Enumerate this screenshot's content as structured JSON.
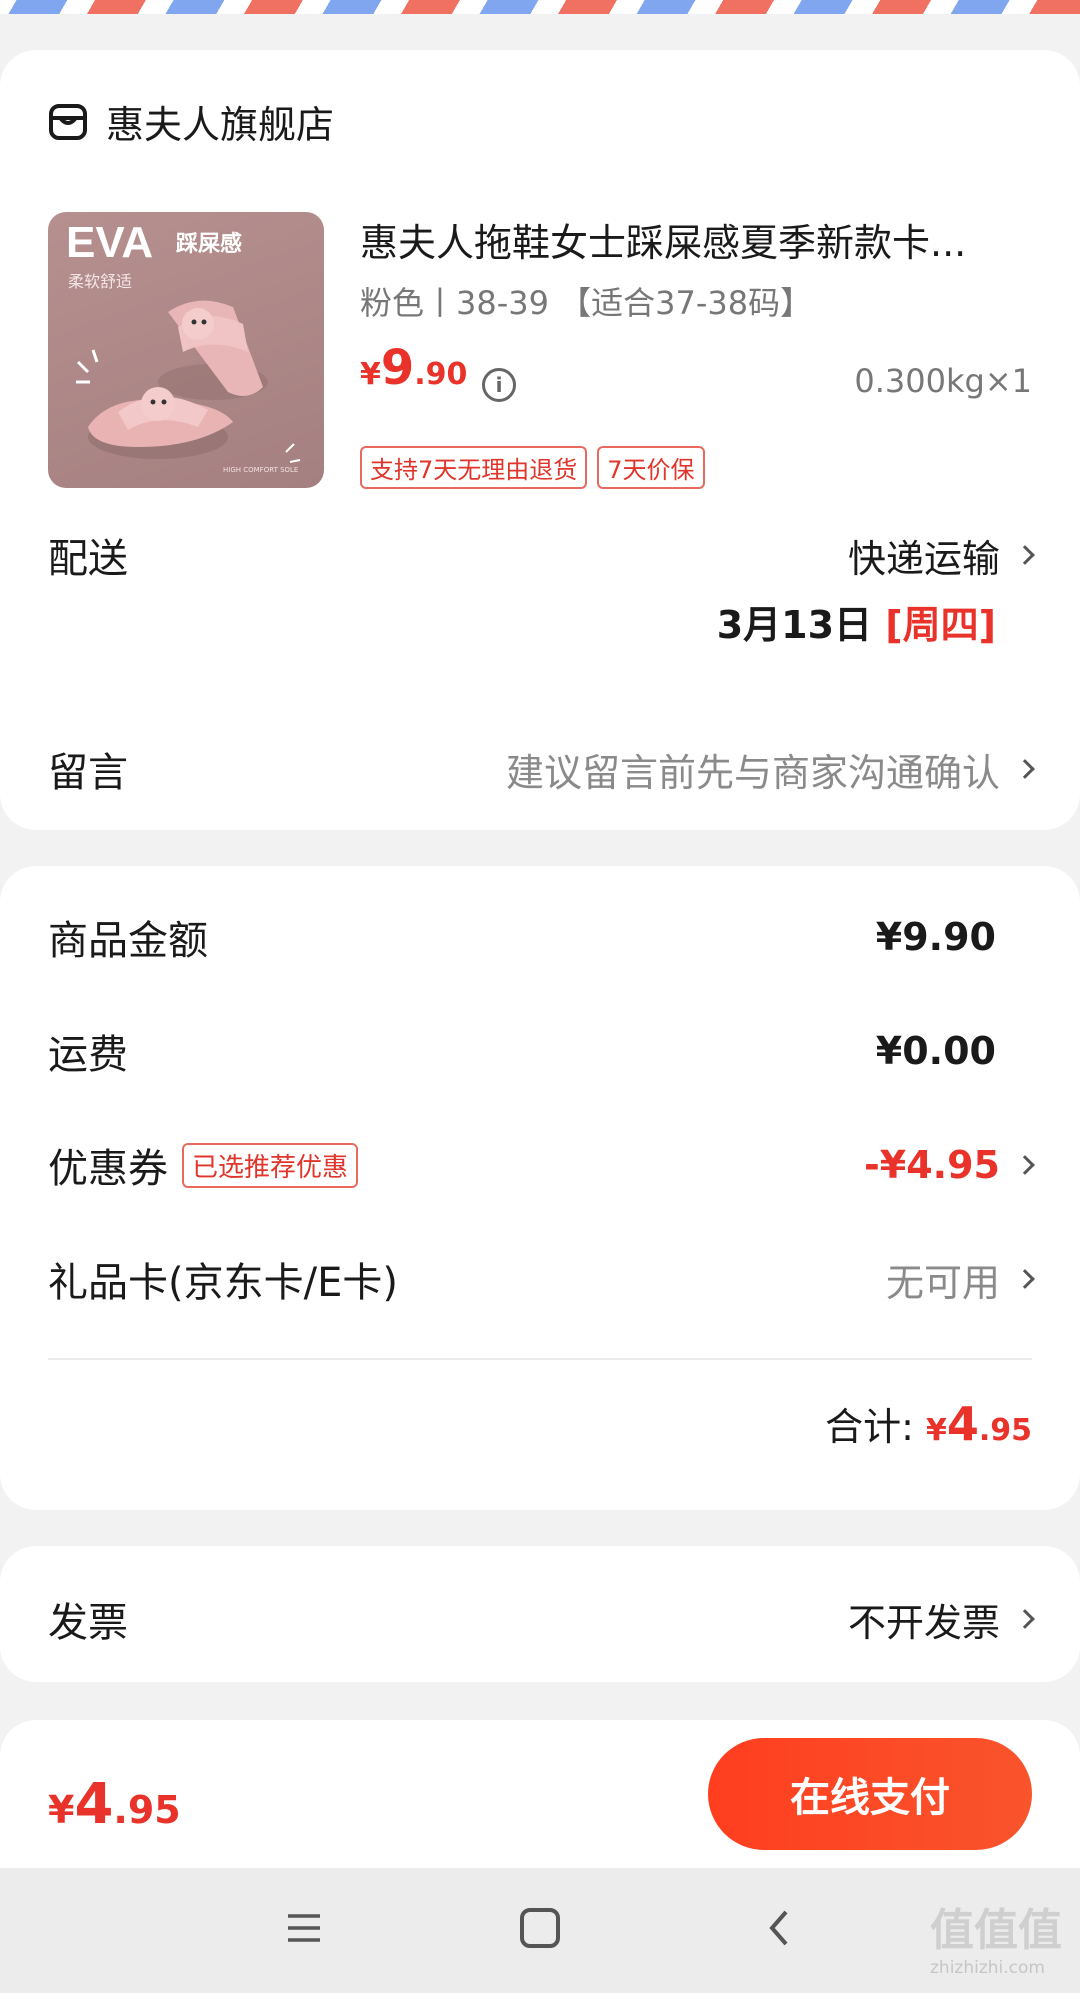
{
  "store": {
    "name": "惠夫人旗舰店",
    "icon": "store-icon"
  },
  "product": {
    "image_texts": {
      "brand": "EVA",
      "tag": "踩屎感",
      "subtitle": "柔软舒适",
      "small": "HIGH COMFORT SOLE"
    },
    "title": "惠夫人拖鞋女士踩屎感夏季新款卡...",
    "spec": "粉色丨38-39 【适合37-38码】",
    "price_symbol": "¥",
    "price_int": "9",
    "price_dec": ".90",
    "weight_qty": "0.300kg×1",
    "tags": [
      "支持7天无理由退货",
      "7天价保"
    ]
  },
  "delivery": {
    "label": "配送",
    "method": "快递运输",
    "date": "3月13日",
    "weekday": "[周四]"
  },
  "message": {
    "label": "留言",
    "placeholder": "建议留言前先与商家沟通确认"
  },
  "summary": {
    "goods_label": "商品金额",
    "goods_value": "¥9.90",
    "shipping_label": "运费",
    "shipping_value": "¥0.00",
    "coupon_label": "优惠券",
    "coupon_tag": "已选推荐优惠",
    "coupon_value": "-¥4.95",
    "giftcard_label": "礼品卡(京东卡/E卡)",
    "giftcard_value": "无可用",
    "total_label": "合计:",
    "total_symbol": "¥",
    "total_int": "4",
    "total_dec": ".95"
  },
  "invoice": {
    "label": "发票",
    "value": "不开发票"
  },
  "footer": {
    "symbol": "¥",
    "int": "4",
    "dec": ".95",
    "pay_label": "在线支付"
  },
  "watermark": "值值值",
  "watermark_url": "zhizhizhi.com",
  "colors": {
    "accent": "#e8322a",
    "pay_button": "#ff3e1f"
  }
}
